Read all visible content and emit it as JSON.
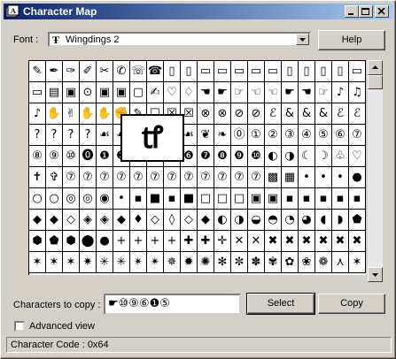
{
  "window": {
    "title": "Character Map",
    "title_icon": "character-map-icon",
    "controls": [
      "minimize-icon",
      "maximize-icon",
      "close-icon"
    ]
  },
  "font": {
    "label": "Font :",
    "selected": "Wingdings 2",
    "selected_icon": "truetype-font-icon"
  },
  "help_button": "Help",
  "grid": {
    "rows": [
      [
        "✎",
        "✒",
        "✑",
        "✐",
        "✂",
        "✆",
        "☏",
        "☎",
        "▯",
        "▯",
        "▭",
        "▭",
        "▭",
        "▭",
        "▭",
        "▯",
        "▯",
        "▯",
        "▯",
        "▭"
      ],
      [
        "▭",
        "▤",
        "▣",
        "⊙",
        "▣",
        "▣",
        "▢",
        "✍",
        "♡",
        "♢",
        "☚",
        "☛",
        "☞",
        "☜",
        "☜",
        "☛",
        "☚",
        "☞",
        "♪",
        "♫"
      ],
      [
        "♪",
        "✋",
        "✌",
        "✋",
        "✋",
        "✊",
        "✎",
        "☐",
        "☒",
        "☒",
        "⊗",
        "⊗",
        "⊘",
        "⊘",
        "ℰ",
        "&",
        "&",
        "&",
        "ℰ",
        "ℰ"
      ],
      [
        "?",
        "?",
        "?",
        "?",
        "☙",
        "☙",
        "❦",
        "❧",
        "☙",
        "☙",
        "❦",
        "❧",
        "⓪",
        "①",
        "②",
        "③",
        "④",
        "⑤",
        "⑥",
        "⑦"
      ],
      [
        "⑧",
        "⑨",
        "⑩",
        "⓿",
        "❶",
        "❷",
        "❸",
        "❹",
        "❺",
        "❻",
        "❼",
        "❽",
        "❾",
        "❿",
        "◐",
        "◑",
        "☾",
        "☽",
        "♧",
        "♡"
      ],
      [
        "✝",
        "✞",
        "⑦",
        "⑦",
        "⑦",
        "⑦",
        "⑦",
        "⑦",
        "⑦",
        "⑦",
        "⑦",
        "⑦",
        "⑦",
        "⑦",
        "▩",
        "▦",
        "•",
        "•",
        "•",
        "●"
      ],
      [
        "○",
        "○",
        "◎",
        "◎",
        "◉",
        "•",
        "▪",
        "■",
        "▪",
        "■",
        "□",
        "□",
        "□",
        "▣",
        "▣",
        "▪",
        "▪",
        "▪",
        "▪",
        "▪"
      ],
      [
        "◆",
        "◆",
        "◇",
        "◈",
        "◈",
        "◆",
        "♦",
        "◇",
        "◊",
        "◇",
        "◆",
        "◐",
        "◑",
        "◒",
        "◓",
        "◔",
        "◕",
        "◖",
        "◗",
        "⬟"
      ],
      [
        "⬢",
        "⬟",
        "⬢",
        "⬤",
        "●",
        "+",
        "+",
        "+",
        "+",
        "✚",
        "✚",
        "✛",
        "✕",
        "✕",
        "✖",
        "✖",
        "✖",
        "✖",
        "✖",
        "✖"
      ],
      [
        "✶",
        "✶",
        "✶",
        "✷",
        "✳",
        "✳",
        "✴",
        "✴",
        "✵",
        "✹",
        "✺",
        "✻",
        "✼",
        "✽",
        "✾",
        "✿",
        "❀",
        "❁",
        "⋏",
        "✶"
      ]
    ]
  },
  "zoom_char": "ꝷ",
  "copy": {
    "label": "Characters to copy :",
    "value": "☛⑩⑨⑥❶⑤",
    "select_button": "Select",
    "copy_button": "Copy"
  },
  "advanced": {
    "label": "Advanced view",
    "checked": false
  },
  "status": "Character Code : 0x64"
}
